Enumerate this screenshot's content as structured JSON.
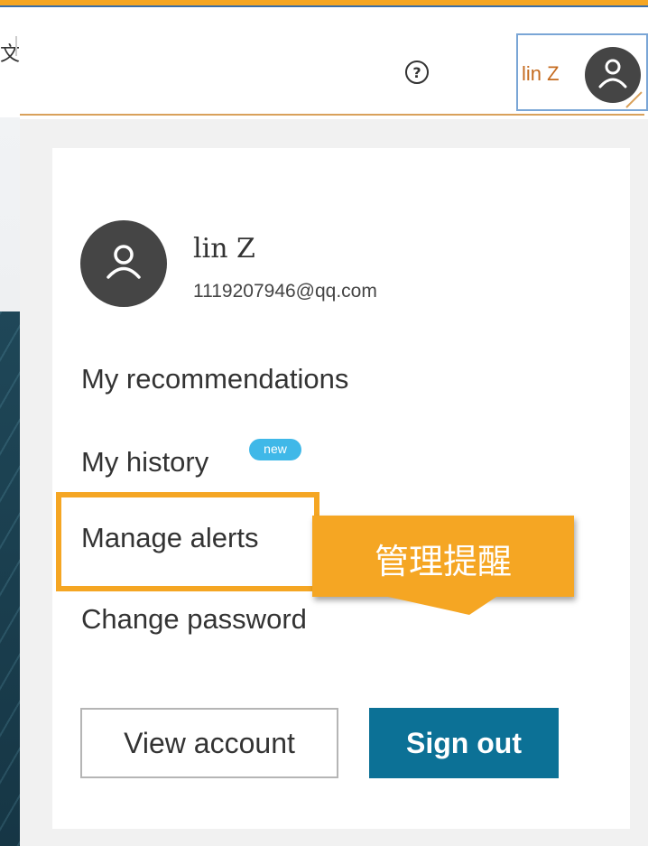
{
  "colors": {
    "accent_orange": "#f5a623",
    "primary_blue": "#0c7196",
    "new_badge": "#3fb8e8",
    "avatar_bg": "#454545"
  },
  "header": {
    "edge_text": "文",
    "help_icon": "question-circle-icon",
    "help_glyph": "?",
    "user_button": {
      "name": "lin Z",
      "avatar_icon": "user-icon"
    }
  },
  "dropdown": {
    "user": {
      "name": "lin Z",
      "email": "1119207946@qq.com",
      "avatar_icon": "user-icon"
    },
    "menu": {
      "recommendations": "My recommendations",
      "history": "My history",
      "history_badge": "new",
      "alerts": "Manage alerts",
      "password": "Change password"
    },
    "buttons": {
      "view_account": "View account",
      "sign_out": "Sign out"
    }
  },
  "annotation": {
    "callout_text": "管理提醒"
  }
}
